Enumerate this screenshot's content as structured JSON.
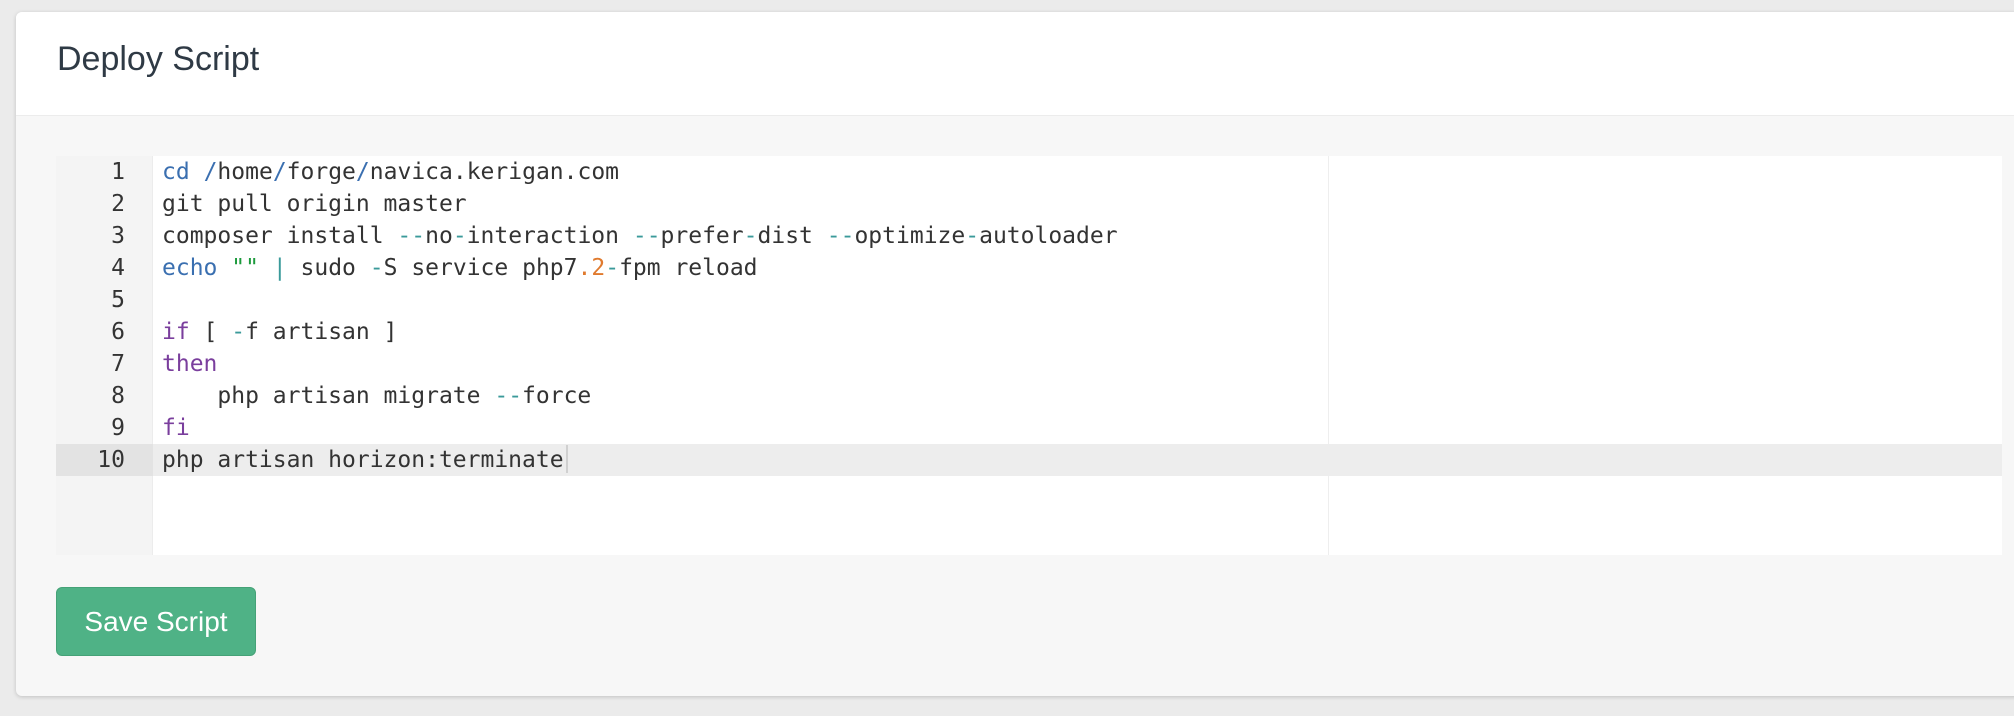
{
  "panel": {
    "title": "Deploy Script"
  },
  "editor": {
    "active_line": 10,
    "lines": [
      {
        "number": "1",
        "tokens": [
          {
            "t": "cd",
            "c": "#3a6fb0"
          },
          {
            "t": " ",
            "c": "#333333"
          },
          {
            "t": "/",
            "c": "#3a6fb0"
          },
          {
            "t": "home",
            "c": "#333333"
          },
          {
            "t": "/",
            "c": "#3a6fb0"
          },
          {
            "t": "forge",
            "c": "#333333"
          },
          {
            "t": "/",
            "c": "#3a6fb0"
          },
          {
            "t": "navica.kerigan.com",
            "c": "#333333"
          }
        ]
      },
      {
        "number": "2",
        "tokens": [
          {
            "t": "git pull origin master",
            "c": "#333333"
          }
        ]
      },
      {
        "number": "3",
        "tokens": [
          {
            "t": "composer install ",
            "c": "#333333"
          },
          {
            "t": "--",
            "c": "#3a9a9a"
          },
          {
            "t": "no",
            "c": "#333333"
          },
          {
            "t": "-",
            "c": "#3a9a9a"
          },
          {
            "t": "interaction ",
            "c": "#333333"
          },
          {
            "t": "--",
            "c": "#3a9a9a"
          },
          {
            "t": "prefer",
            "c": "#333333"
          },
          {
            "t": "-",
            "c": "#3a9a9a"
          },
          {
            "t": "dist ",
            "c": "#333333"
          },
          {
            "t": "--",
            "c": "#3a9a9a"
          },
          {
            "t": "optimize",
            "c": "#333333"
          },
          {
            "t": "-",
            "c": "#3a9a9a"
          },
          {
            "t": "autoloader",
            "c": "#333333"
          }
        ]
      },
      {
        "number": "4",
        "tokens": [
          {
            "t": "echo",
            "c": "#3a6fb0"
          },
          {
            "t": " ",
            "c": "#333333"
          },
          {
            "t": "\"\"",
            "c": "#1c9a3c"
          },
          {
            "t": " ",
            "c": "#333333"
          },
          {
            "t": "|",
            "c": "#3a9a9a"
          },
          {
            "t": " sudo ",
            "c": "#333333"
          },
          {
            "t": "-",
            "c": "#3a9a9a"
          },
          {
            "t": "S service php7",
            "c": "#333333"
          },
          {
            "t": ".2",
            "c": "#e07a2e"
          },
          {
            "t": "-",
            "c": "#3a9a9a"
          },
          {
            "t": "fpm reload",
            "c": "#333333"
          }
        ]
      },
      {
        "number": "5",
        "tokens": []
      },
      {
        "number": "6",
        "tokens": [
          {
            "t": "if",
            "c": "#7a3e9d"
          },
          {
            "t": " [ ",
            "c": "#333333"
          },
          {
            "t": "-",
            "c": "#3a9a9a"
          },
          {
            "t": "f artisan ]",
            "c": "#333333"
          }
        ]
      },
      {
        "number": "7",
        "tokens": [
          {
            "t": "then",
            "c": "#7a3e9d"
          }
        ]
      },
      {
        "number": "8",
        "tokens": [
          {
            "t": "    php artisan migrate ",
            "c": "#333333"
          },
          {
            "t": "--",
            "c": "#3a9a9a"
          },
          {
            "t": "force",
            "c": "#333333"
          }
        ]
      },
      {
        "number": "9",
        "tokens": [
          {
            "t": "fi",
            "c": "#7a3e9d"
          }
        ]
      },
      {
        "number": "10",
        "tokens": [
          {
            "t": "php artisan horizon:terminate",
            "c": "#333333"
          }
        ]
      }
    ]
  },
  "actions": {
    "save_label": "Save Script"
  },
  "colors": {
    "save_button": "#4fb286",
    "keyword_builtin": "#3a6fb0",
    "keyword_control": "#7a3e9d",
    "operator": "#3a9a9a",
    "string": "#1c9a3c",
    "number": "#e07a2e"
  }
}
